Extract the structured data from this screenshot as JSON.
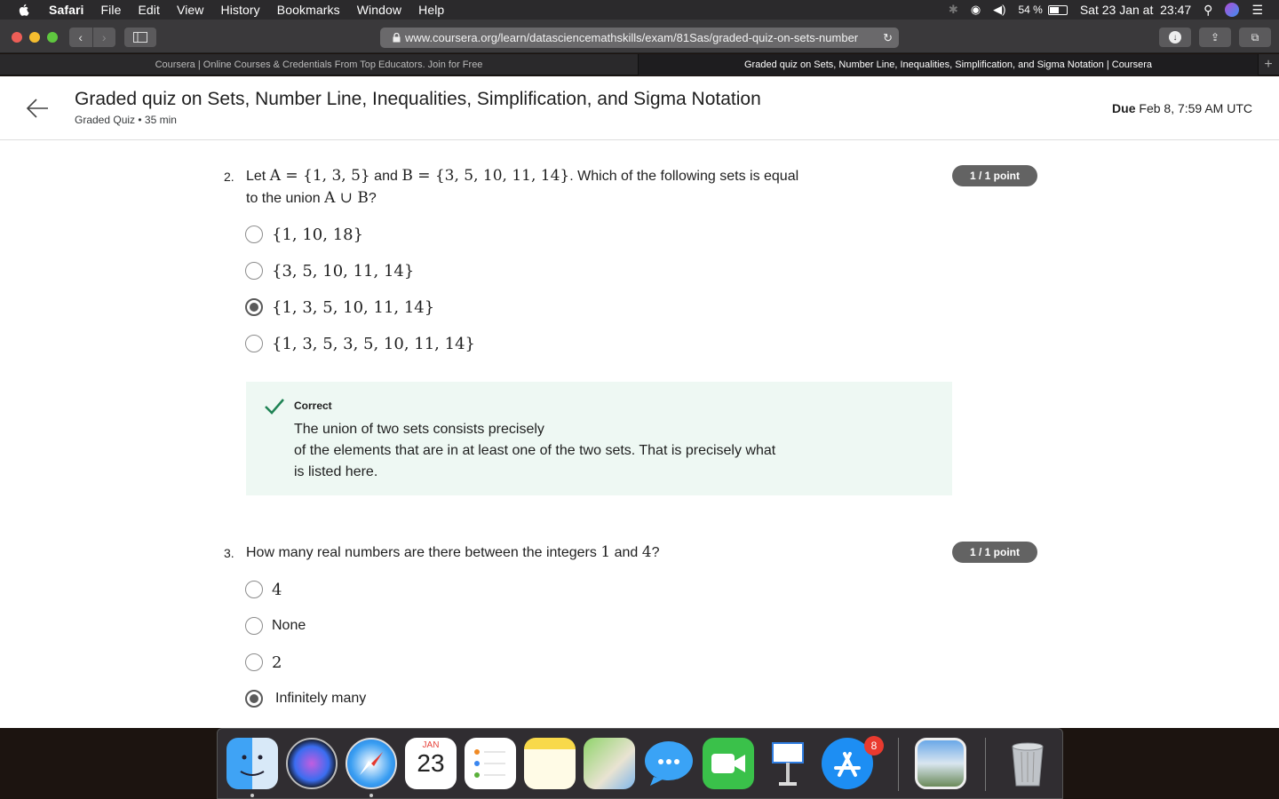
{
  "menubar": {
    "app": "Safari",
    "items": [
      "File",
      "Edit",
      "View",
      "History",
      "Bookmarks",
      "Window",
      "Help"
    ],
    "battery": "54 %",
    "clock": "Sat 23 Jan at  23:47"
  },
  "browser": {
    "url": "www.coursera.org/learn/datasciencemathskills/exam/81Sas/graded-quiz-on-sets-number",
    "tabs": [
      {
        "label": "Coursera | Online Courses & Credentials From Top Educators. Join for Free",
        "active": false
      },
      {
        "label": "Graded quiz on Sets, Number Line, Inequalities, Simplification, and Sigma Notation | Coursera",
        "active": true
      }
    ]
  },
  "header": {
    "title": "Graded quiz on Sets, Number Line, Inequalities, Simplification, and Sigma Notation",
    "subtitle": "Graded Quiz • 35 min",
    "due_label": "Due",
    "due_value": "Feb 8, 7:59 AM UTC"
  },
  "questions": [
    {
      "number": "2.",
      "text_line1_a": "Let ",
      "text_line1_math1": "A = {1, 3, 5}",
      "text_line1_b": " and ",
      "text_line1_math2": "B = {3, 5, 10, 11, 14}",
      "text_line1_c": ". Which of the following sets is equal",
      "text_line2_a": "to the union ",
      "text_line2_math": "A ∪ B",
      "text_line2_b": "?",
      "points": "1 / 1 point",
      "options": [
        {
          "label": "{1, 10, 18}",
          "checked": false
        },
        {
          "label": "{3, 5, 10, 11, 14}",
          "checked": false
        },
        {
          "label": "{1, 3, 5, 10, 11, 14}",
          "checked": true
        },
        {
          "label": "{1, 3, 5, 3, 5, 10, 11, 14}",
          "checked": false
        }
      ],
      "feedback": {
        "title": "Correct",
        "line1": "The union of two sets consists precisely",
        "line2": "of the elements that are in at least one of the two sets. That is precisely what",
        "line3": "is listed here."
      }
    },
    {
      "number": "3.",
      "text_a": "How many real numbers are there between the integers ",
      "text_math1": "1",
      "text_b": " and ",
      "text_math2": "4",
      "text_c": "?",
      "points": "1 / 1 point",
      "options": [
        {
          "label": "4",
          "checked": false
        },
        {
          "label": "None",
          "checked": false
        },
        {
          "label": "2",
          "checked": false
        },
        {
          "label": "Infinitely many",
          "checked": true
        }
      ]
    }
  ],
  "dock": {
    "calendar_month": "JAN",
    "calendar_day": "23",
    "appstore_badge": "8",
    "icons": [
      "finder-icon",
      "siri-icon",
      "safari-icon",
      "calendar-icon",
      "reminders-icon",
      "notes-icon",
      "maps-icon",
      "messages-icon",
      "facetime-icon",
      "keynote-icon",
      "app-store-icon",
      "preview-icon",
      "trash-icon"
    ]
  }
}
